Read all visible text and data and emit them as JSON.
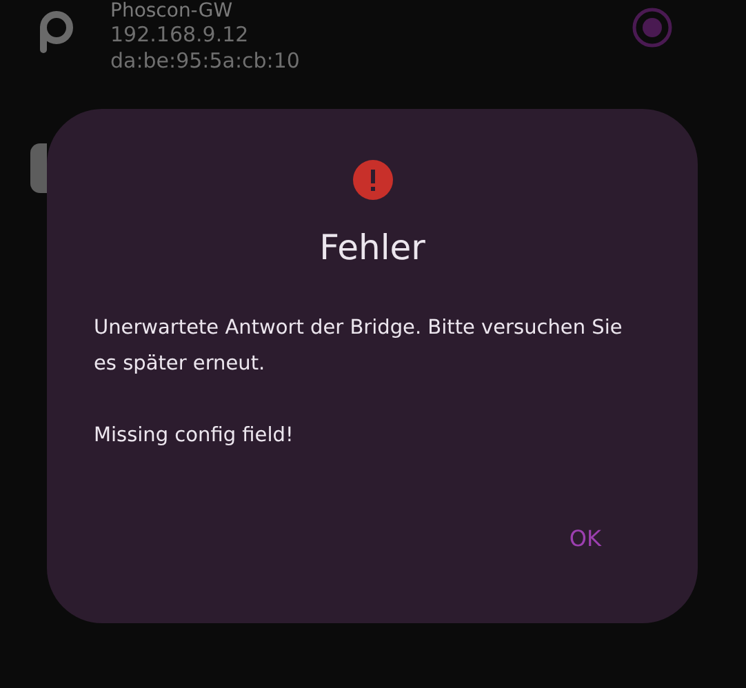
{
  "devices": [
    {
      "name": "Phoscon-GW",
      "ip": "192.168.9.12",
      "mac": "da:be:95:5a:cb:10",
      "selected": true
    }
  ],
  "dialog": {
    "title": "Fehler",
    "message": "Unerwartete Antwort der Bridge. Bitte versuchen Sie es später erneut.",
    "detail": "Missing config field!",
    "button": "OK"
  }
}
